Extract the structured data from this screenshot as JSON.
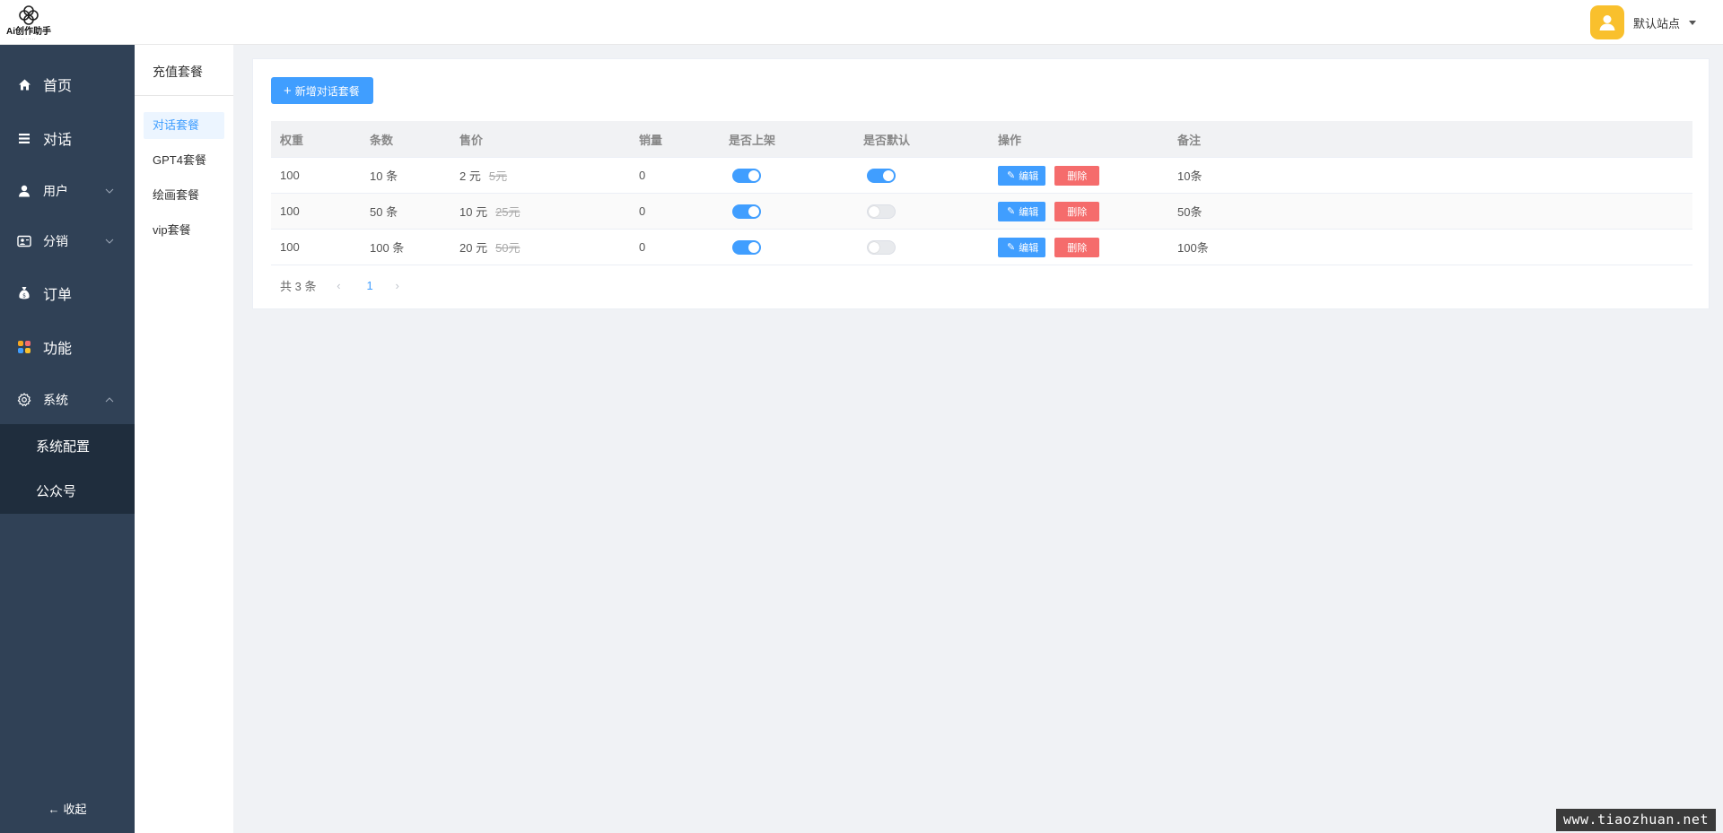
{
  "header": {
    "logo_text": "Ai创作助手",
    "site_name": "默认站点",
    "colors": {
      "avatar_bg": "#f9c02d"
    }
  },
  "sidebar": {
    "items": [
      {
        "label": "首页",
        "icon": "home-icon"
      },
      {
        "label": "对话",
        "icon": "list-icon"
      },
      {
        "label": "用户",
        "icon": "user-icon"
      },
      {
        "label": "分销",
        "icon": "id-card-icon"
      },
      {
        "label": "订单",
        "icon": "money-bag-icon"
      },
      {
        "label": "功能",
        "icon": "apps-icon"
      },
      {
        "label": "系统",
        "icon": "gear-icon"
      }
    ],
    "submenu": [
      "系统配置",
      "公众号"
    ],
    "collapse_label": "收起",
    "colors": {
      "bg": "#304156",
      "submenu_bg": "#1f2d3d"
    }
  },
  "submenu2": {
    "title": "充值套餐",
    "items": [
      "对话套餐",
      "GPT4套餐",
      "绘画套餐",
      "vip套餐"
    ],
    "active_index": 0
  },
  "main": {
    "add_button": "新增对话套餐",
    "table": {
      "headers": [
        "权重",
        "条数",
        "售价",
        "销量",
        "是否上架",
        "是否默认",
        "操作",
        "备注"
      ],
      "rows": [
        {
          "weight": "100",
          "count": "10 条",
          "price": "2 元",
          "original": "5元",
          "sales": "0",
          "on_sale": true,
          "is_default": true,
          "note": "10条"
        },
        {
          "weight": "100",
          "count": "50 条",
          "price": "10 元",
          "original": "25元",
          "sales": "0",
          "on_sale": true,
          "is_default": false,
          "note": "50条"
        },
        {
          "weight": "100",
          "count": "100 条",
          "price": "20 元",
          "original": "50元",
          "sales": "0",
          "on_sale": true,
          "is_default": false,
          "note": "100条"
        }
      ],
      "actions": {
        "edit": "编辑",
        "delete": "删除"
      }
    },
    "pagination": {
      "total_text": "共 3 条",
      "current_page": "1"
    },
    "colors": {
      "primary": "#409eff",
      "danger": "#f56c6c"
    }
  },
  "watermark": "www.tiaozhuan.net"
}
